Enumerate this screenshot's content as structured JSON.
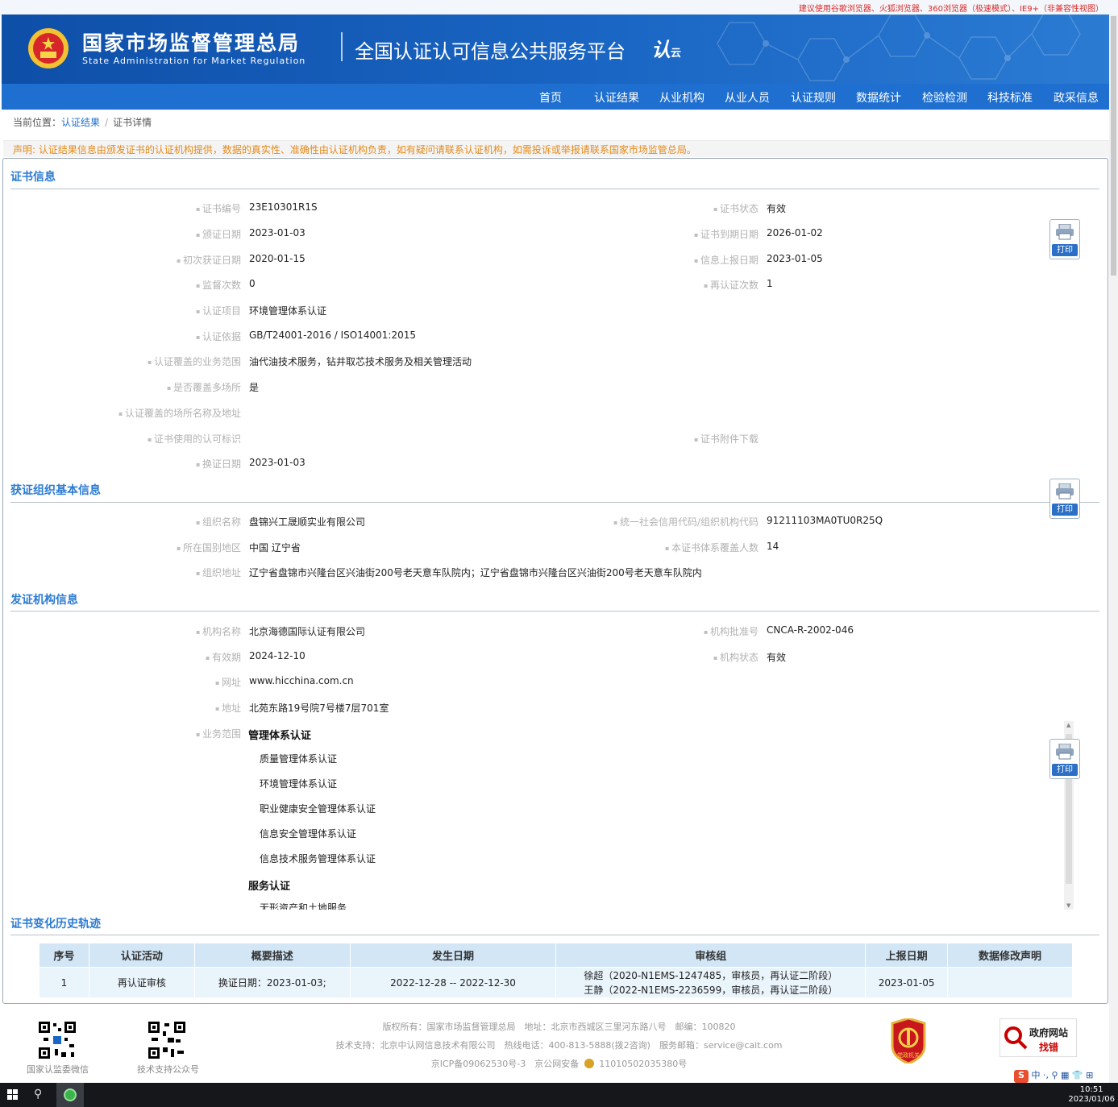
{
  "top_note": "建议使用谷歌浏览器、火狐浏览器、360浏览器（极速模式）、IE9+（非兼容性视图）",
  "header": {
    "org_cn": "国家市场监督管理总局",
    "org_en": "State Administration  for  Market Regulation",
    "platform": "全国认证认可信息公共服务平台",
    "brand_a": "认",
    "brand_b": "云"
  },
  "nav": [
    "首页",
    "认证结果",
    "从业机构",
    "从业人员",
    "认证规则",
    "数据统计",
    "检验检测",
    "科技标准",
    "政采信息"
  ],
  "breadcrumb": {
    "prefix": "当前位置：",
    "link": "认证结果",
    "separator": "/",
    "current": "证书详情"
  },
  "declaration": "声明: 认证结果信息由颁发证书的认证机构提供，数据的真实性、准确性由认证机构负责，如有疑问请联系认证机构，如需投诉或举报请联系国家市场监管总局。",
  "print_label": "打印",
  "cert": {
    "title": "证书信息",
    "fields": [
      {
        "label": "证书编号",
        "value": "23E10301R1S"
      },
      {
        "label": "证书状态",
        "value": "有效"
      },
      {
        "label": "颁证日期",
        "value": "2023-01-03"
      },
      {
        "label": "证书到期日期",
        "value": "2026-01-02"
      },
      {
        "label": "初次获证日期",
        "value": "2020-01-15"
      },
      {
        "label": "信息上报日期",
        "value": "2023-01-05"
      },
      {
        "label": "监督次数",
        "value": "0"
      },
      {
        "label": "再认证次数",
        "value": "1"
      },
      {
        "label": "认证项目",
        "value": "环境管理体系认证"
      },
      {
        "label": "认证依据",
        "value": "GB/T24001-2016 / ISO14001:2015"
      },
      {
        "label": "认证覆盖的业务范围",
        "value": "油代油技术服务，钻井取芯技术服务及相关管理活动"
      },
      {
        "label": "是否覆盖多场所",
        "value": "是"
      },
      {
        "label": "认证覆盖的场所名称及地址",
        "value": ""
      },
      {
        "label": "证书使用的认可标识",
        "value": ""
      },
      {
        "label": "证书附件下载",
        "value": ""
      },
      {
        "label": "换证日期",
        "value": "2023-01-03"
      }
    ]
  },
  "org": {
    "title": "获证组织基本信息",
    "fields": [
      {
        "label": "组织名称",
        "value": "盘锦兴工晟顺实业有限公司"
      },
      {
        "label": "统一社会信用代码/组织机构代码",
        "value": "91211103MA0TU0R25Q"
      },
      {
        "label": "所在国别地区",
        "value": "中国 辽宁省"
      },
      {
        "label": "本证书体系覆盖人数",
        "value": "14"
      },
      {
        "label": "组织地址",
        "value": "辽宁省盘锦市兴隆台区兴油街200号老天意车队院内；辽宁省盘锦市兴隆台区兴油街200号老天意车队院内"
      }
    ]
  },
  "issuer": {
    "title": "发证机构信息",
    "fields": [
      {
        "label": "机构名称",
        "value": "北京海德国际认证有限公司"
      },
      {
        "label": "机构批准号",
        "value": "CNCA-R-2002-046"
      },
      {
        "label": "有效期",
        "value": "2024-12-10"
      },
      {
        "label": "机构状态",
        "value": "有效"
      },
      {
        "label": "网址",
        "value": "www.hicchina.com.cn"
      },
      {
        "label": "地址",
        "value": "北苑东路19号院7号楼7层701室"
      }
    ],
    "scope_label": "业务范围",
    "scope": [
      {
        "category": "管理体系认证",
        "items": [
          "质量管理体系认证",
          "环境管理体系认证",
          "职业健康安全管理体系认证",
          "信息安全管理体系认证",
          "信息技术服务管理体系认证"
        ]
      },
      {
        "category": "服务认证",
        "items": [
          "无形资产和土地服务"
        ]
      }
    ]
  },
  "history": {
    "title": "证书变化历史轨迹",
    "headers": [
      "序号",
      "认证活动",
      "概要描述",
      "发生日期",
      "审核组",
      "上报日期",
      "数据修改声明"
    ],
    "rows": [
      {
        "no": "1",
        "activity": "再认证审核",
        "summary": "换证日期：2023-01-03;",
        "date": "2022-12-28 -- 2022-12-30",
        "team_1": "徐超（2020-N1EMS-1247485，审核员，再认证二阶段）",
        "team_2": "王静（2022-N1EMS-2236599，审核员，再认证二阶段）",
        "report_date": "2023-01-05",
        "statement": ""
      }
    ]
  },
  "footer": {
    "qr1_caption": "国家认监委微信",
    "qr2_caption": "技术支持公众号",
    "line1": "版权所有：国家市场监督管理总局　地址：北京市西城区三里河东路八号　邮编：100820",
    "line2": "技术支持：北京中认网信息技术有限公司　热线电话：400-813-5888(拨2咨询)　服务邮箱：service@cait.com",
    "line3_a": "京ICP备09062530号-3　京公网安备",
    "line3_b": "11010502035380号",
    "party_label": "党政机关",
    "gov_t1": "政府网站",
    "gov_t2": "找错",
    "ime": "中 ·, ⚲ ▦ 👕 ⊞"
  },
  "taskbar": {
    "time": "10:51",
    "date": "2023/01/06"
  }
}
